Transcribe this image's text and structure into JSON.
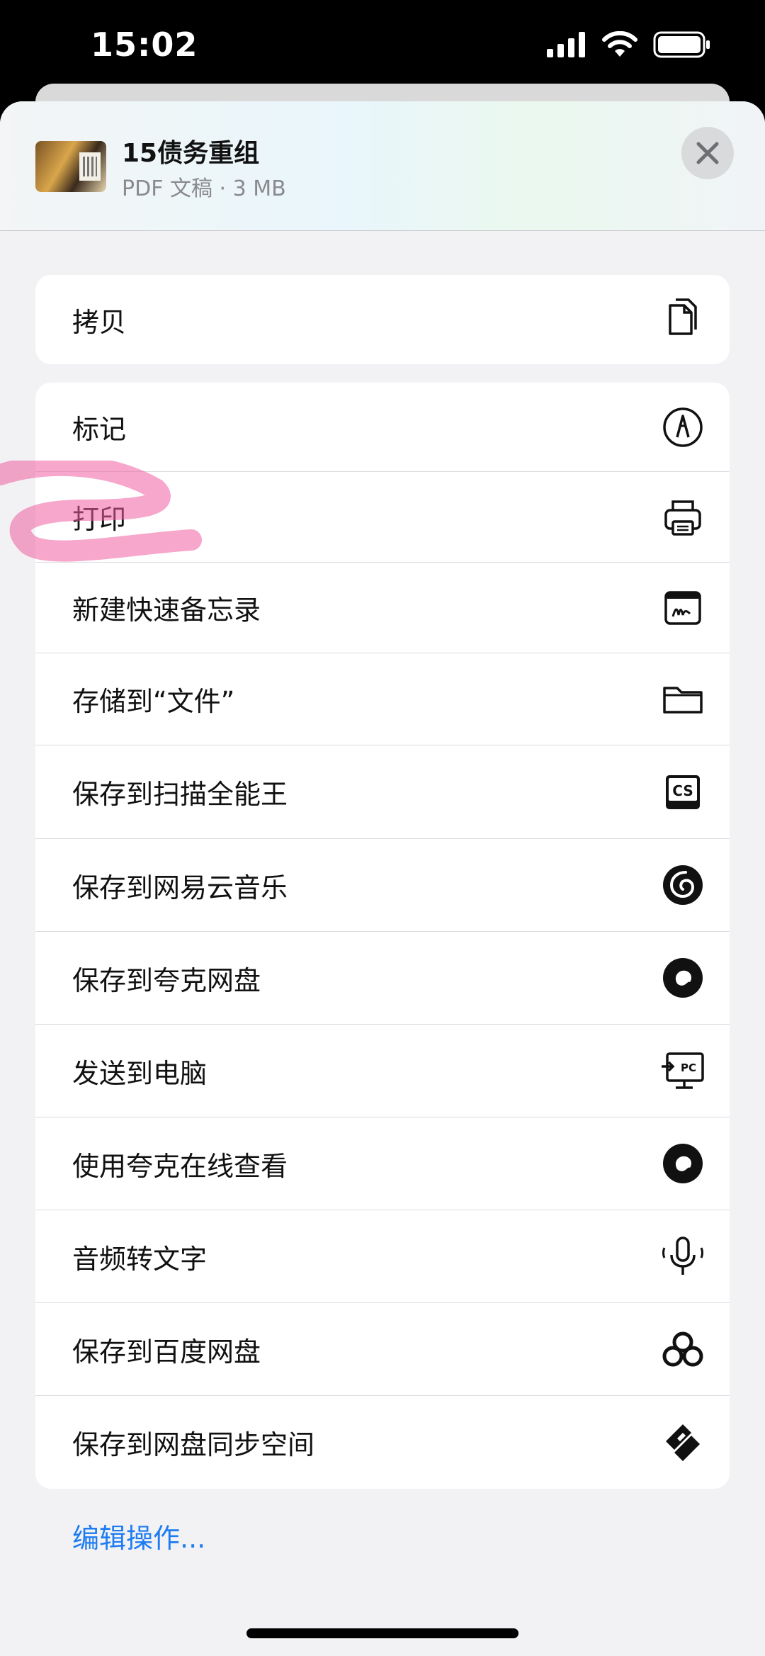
{
  "status_bar": {
    "time": "15:02"
  },
  "share_sheet": {
    "file_title": "15债务重组",
    "file_subtitle": "PDF 文稿 · 3 MB",
    "close_icon": "xmark-icon"
  },
  "groups": [
    {
      "items": [
        {
          "label": "拷贝",
          "icon": "copy-icon"
        }
      ]
    },
    {
      "items": [
        {
          "label": "标记",
          "icon": "markup-icon"
        },
        {
          "label": "打印",
          "icon": "printer-icon"
        },
        {
          "label": "新建快速备忘录",
          "icon": "quick-note-icon"
        },
        {
          "label": "存储到“文件”",
          "icon": "folder-icon"
        },
        {
          "label": "保存到扫描全能王",
          "icon": "camscanner-icon"
        },
        {
          "label": "保存到网易云音乐",
          "icon": "netease-music-icon"
        },
        {
          "label": "保存到夸克网盘",
          "icon": "quark-icon"
        },
        {
          "label": "发送到电脑",
          "icon": "send-to-pc-icon"
        },
        {
          "label": "使用夸克在线查看",
          "icon": "quark-icon"
        },
        {
          "label": "音频转文字",
          "icon": "microphone-icon"
        },
        {
          "label": "保存到百度网盘",
          "icon": "baidu-netdisk-icon"
        },
        {
          "label": "保存到网盘同步空间",
          "icon": "sync-space-icon"
        }
      ]
    }
  ],
  "edit_actions": "编辑操作..."
}
